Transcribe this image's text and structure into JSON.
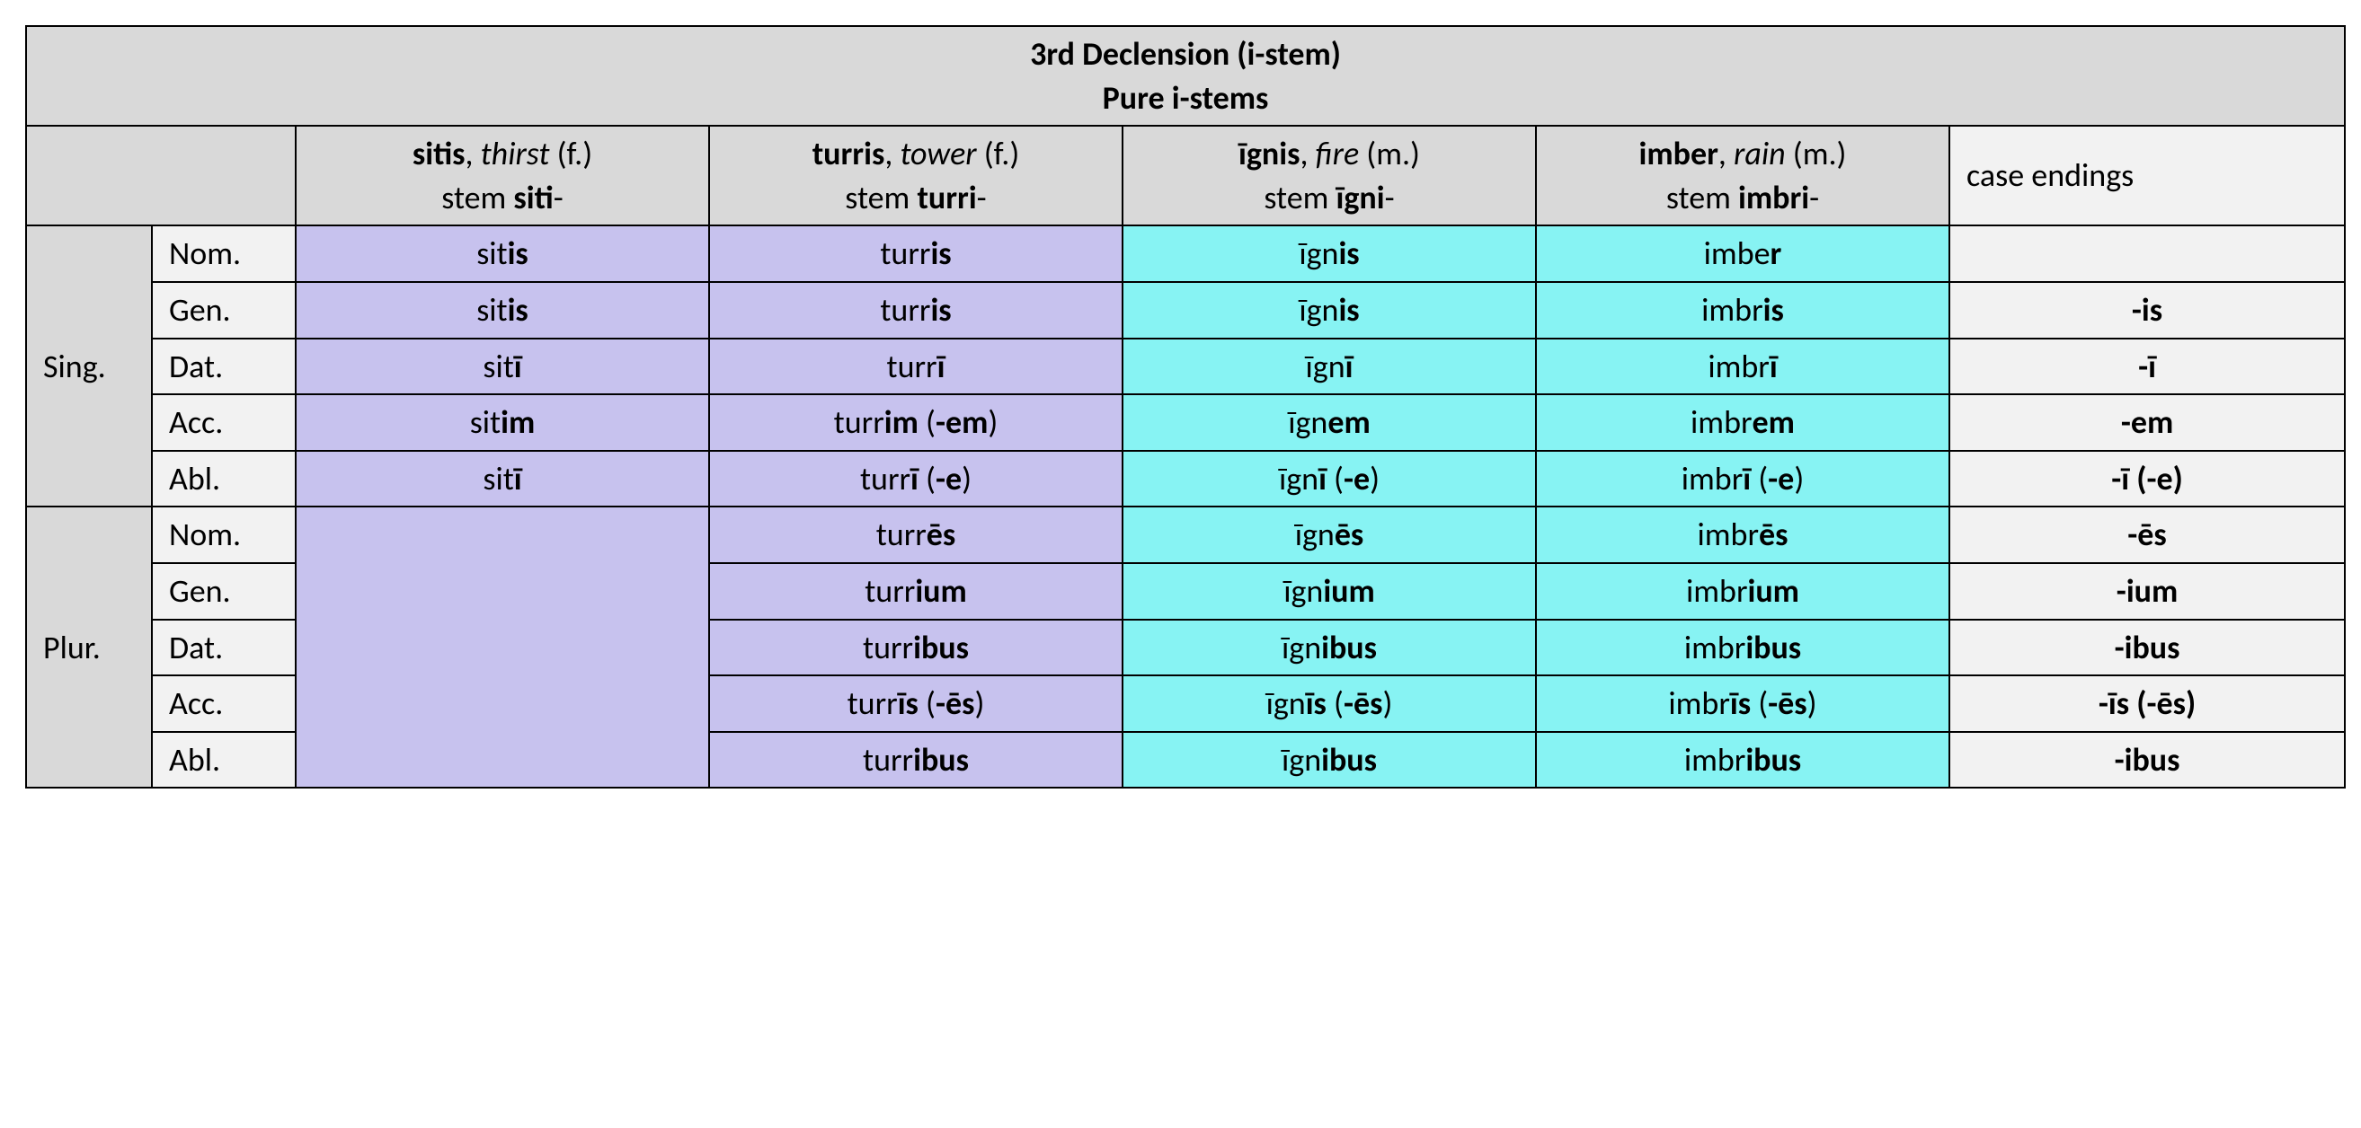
{
  "title_line1": "3rd Declension (i-stem)",
  "title_line2": "Pure i-stems",
  "headers": {
    "sitis": {
      "word": "sitis",
      "gloss": "thirst",
      "gender": "(f.)",
      "stem_label": "stem ",
      "stem_bold": "siti",
      "stem_suffix": "-"
    },
    "turris": {
      "word": "turris",
      "gloss": "tower",
      "gender": "(f.)",
      "stem_label": "stem ",
      "stem_bold": "turri",
      "stem_suffix": "-"
    },
    "ignis": {
      "word": "īgnis",
      "gloss": "fire",
      "gender": "(m.)",
      "stem_label": "stem ",
      "stem_bold": "īgni",
      "stem_suffix": "-"
    },
    "imber": {
      "word": "imber",
      "gloss": "rain",
      "gender": "(m.)",
      "stem_label": "stem ",
      "stem_bold": "imbri",
      "stem_suffix": "-"
    },
    "endings": "case endings"
  },
  "numbers": {
    "sing": "Sing.",
    "plur": "Plur."
  },
  "cases": {
    "nom": "Nom.",
    "gen": "Gen.",
    "dat": "Dat.",
    "acc": "Acc.",
    "abl": "Abl."
  },
  "cells": {
    "sing": {
      "nom": {
        "sitis": {
          "pre": "sit",
          "b": "is",
          "post": ""
        },
        "turris": {
          "pre": "turr",
          "b": "is",
          "post": ""
        },
        "ignis": {
          "pre": "īgn",
          "b": "is",
          "post": ""
        },
        "imber": {
          "pre": "imbe",
          "b": "r",
          "post": ""
        },
        "ending": ""
      },
      "gen": {
        "sitis": {
          "pre": "sit",
          "b": "is",
          "post": ""
        },
        "turris": {
          "pre": "turr",
          "b": "is",
          "post": ""
        },
        "ignis": {
          "pre": "īgn",
          "b": "is",
          "post": ""
        },
        "imber": {
          "pre": "imbr",
          "b": "is",
          "post": ""
        },
        "ending": "-is"
      },
      "dat": {
        "sitis": {
          "pre": "sit",
          "b": "ī",
          "post": ""
        },
        "turris": {
          "pre": "turr",
          "b": "ī",
          "post": ""
        },
        "ignis": {
          "pre": "īgn",
          "b": "ī",
          "post": ""
        },
        "imber": {
          "pre": "imbr",
          "b": "ī",
          "post": ""
        },
        "ending": "-ī"
      },
      "acc": {
        "sitis": {
          "pre": "sit",
          "b": "im",
          "post": ""
        },
        "turris": {
          "pre": "turr",
          "b": "im",
          "post": " (",
          "b2": "-em",
          "post2": ")"
        },
        "ignis": {
          "pre": "īgn",
          "b": "em",
          "post": ""
        },
        "imber": {
          "pre": "imbr",
          "b": "em",
          "post": ""
        },
        "ending": "-em"
      },
      "abl": {
        "sitis": {
          "pre": "sit",
          "b": "ī",
          "post": ""
        },
        "turris": {
          "pre": "turr",
          "b": "ī",
          "post": " (",
          "b2": "-e",
          "post2": ")"
        },
        "ignis": {
          "pre": "īgn",
          "b": "ī",
          "post": " (",
          "b2": "-e",
          "post2": ")"
        },
        "imber": {
          "pre": "imbr",
          "b": "ī",
          "post": " (",
          "b2": "-e",
          "post2": ")"
        },
        "ending": "-ī (-e)"
      }
    },
    "plur": {
      "nom": {
        "turris": {
          "pre": "turr",
          "b": "ēs",
          "post": ""
        },
        "ignis": {
          "pre": "īgn",
          "b": "ēs",
          "post": ""
        },
        "imber": {
          "pre": "imbr",
          "b": "ēs",
          "post": ""
        },
        "ending": "-ēs"
      },
      "gen": {
        "turris": {
          "pre": "turr",
          "b": "ium",
          "post": ""
        },
        "ignis": {
          "pre": "īgn",
          "b": "ium",
          "post": ""
        },
        "imber": {
          "pre": "imbr",
          "b": "ium",
          "post": ""
        },
        "ending": "-ium"
      },
      "dat": {
        "turris": {
          "pre": "turr",
          "b": "ibus",
          "post": ""
        },
        "ignis": {
          "pre": "īgn",
          "b": "ibus",
          "post": ""
        },
        "imber": {
          "pre": "imbr",
          "b": "ibus",
          "post": ""
        },
        "ending": "-ibus"
      },
      "acc": {
        "turris": {
          "pre": "turr",
          "b": "īs",
          "post": " (",
          "b2": "-ēs",
          "post2": ")"
        },
        "ignis": {
          "pre": "īgn",
          "b": "īs",
          "post": " (",
          "b2": "-ēs",
          "post2": ")"
        },
        "imber": {
          "pre": "imbr",
          "b": "īs",
          "post": " (",
          "b2": "-ēs",
          "post2": ")"
        },
        "ending": "-īs (-ēs)"
      },
      "abl": {
        "turris": {
          "pre": "turr",
          "b": "ibus",
          "post": ""
        },
        "ignis": {
          "pre": "īgn",
          "b": "ibus",
          "post": ""
        },
        "imber": {
          "pre": "imbr",
          "b": "ibus",
          "post": ""
        },
        "ending": "-ibus"
      }
    }
  }
}
